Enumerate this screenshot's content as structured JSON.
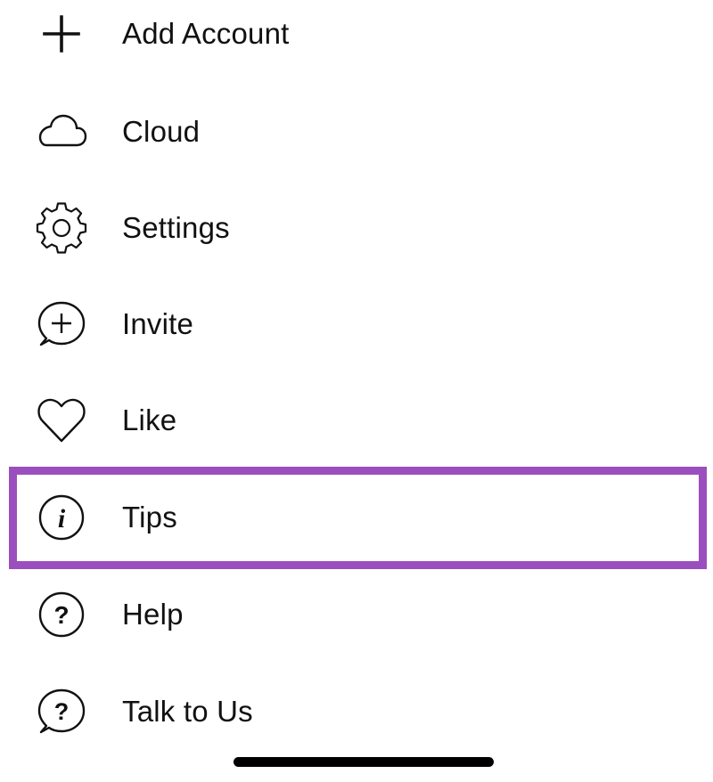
{
  "menu": {
    "items": [
      {
        "label": "Add Account",
        "icon": "plus-icon"
      },
      {
        "label": "Cloud",
        "icon": "cloud-icon"
      },
      {
        "label": "Settings",
        "icon": "gear-icon"
      },
      {
        "label": "Invite",
        "icon": "chat-plus-icon"
      },
      {
        "label": "Like",
        "icon": "heart-icon"
      },
      {
        "label": "Tips",
        "icon": "info-icon"
      },
      {
        "label": "Help",
        "icon": "question-icon"
      },
      {
        "label": "Talk to Us",
        "icon": "chat-question-icon"
      }
    ],
    "highlighted_item": "Tips"
  },
  "colors": {
    "text": "#111111",
    "icon_stroke": "#111111",
    "highlight_border": "#9b4fbf",
    "background": "#ffffff",
    "home_indicator": "#000000"
  }
}
